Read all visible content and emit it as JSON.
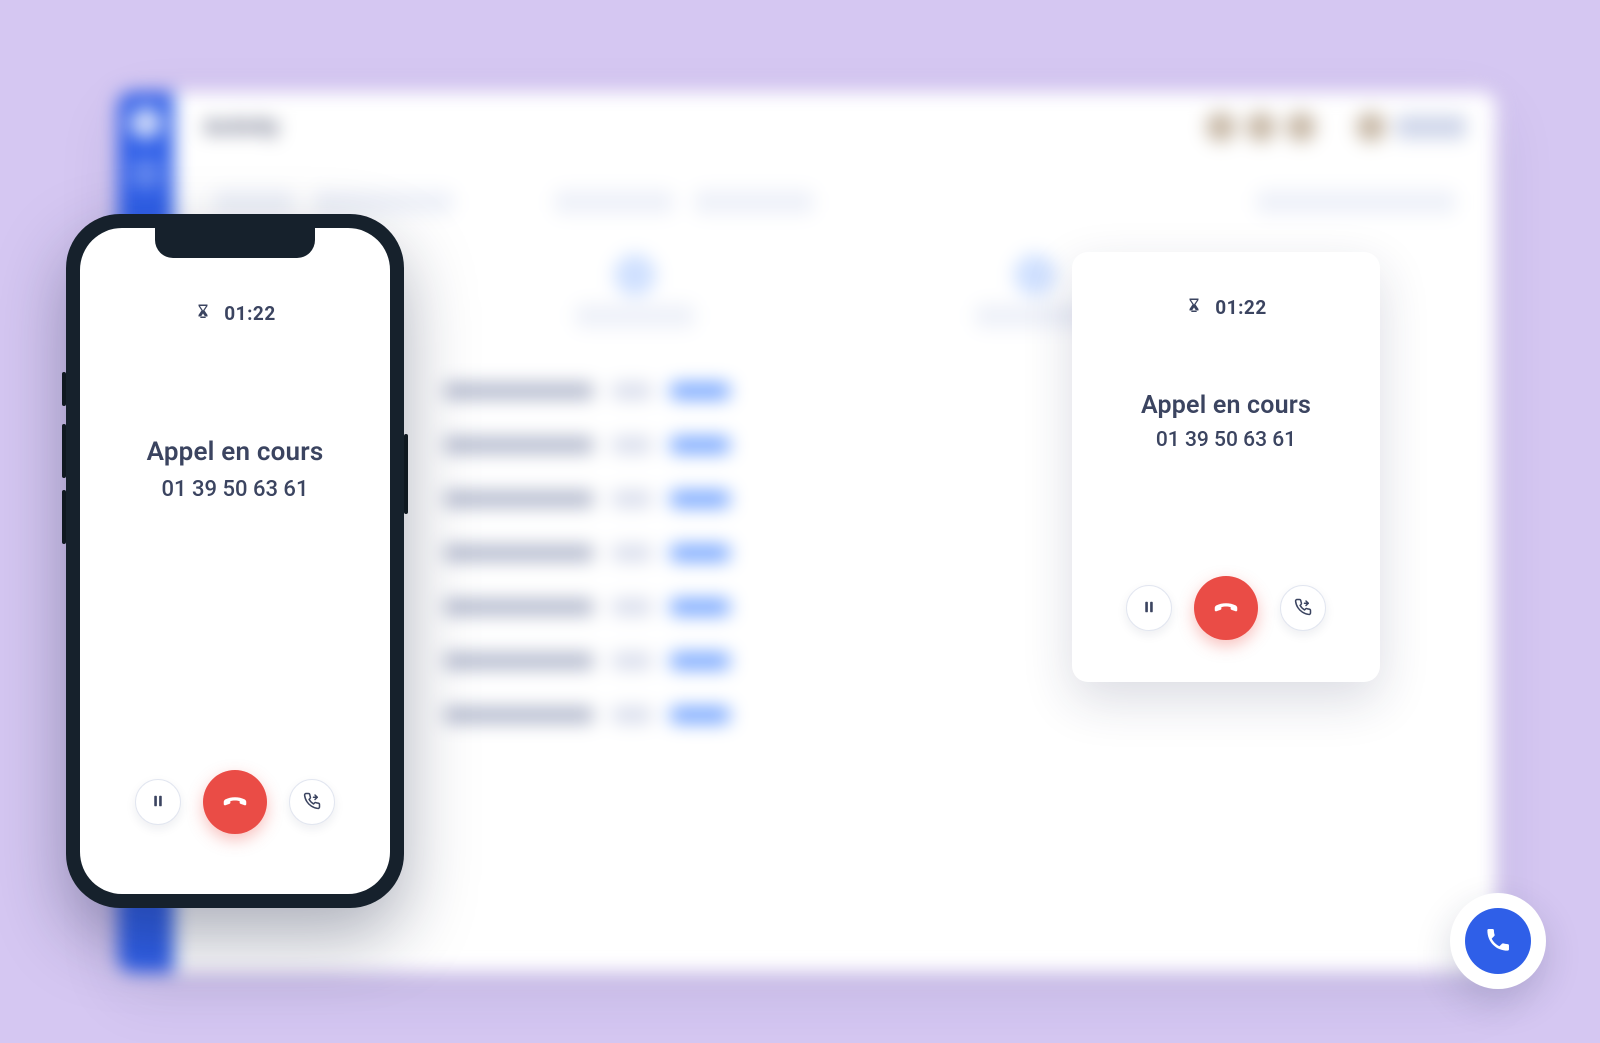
{
  "dashboard": {
    "title": "Activity"
  },
  "phone_call": {
    "duration": "01:22",
    "status": "Appel en cours",
    "number": "01 39 50 63 61"
  },
  "popup_call": {
    "duration": "01:22",
    "status": "Appel en cours",
    "number": "01 39 50 63 61"
  },
  "colors": {
    "primary": "#2f5fe8",
    "hangup": "#ea4c46",
    "text": "#3b4460",
    "background": "#d5c7f2"
  }
}
